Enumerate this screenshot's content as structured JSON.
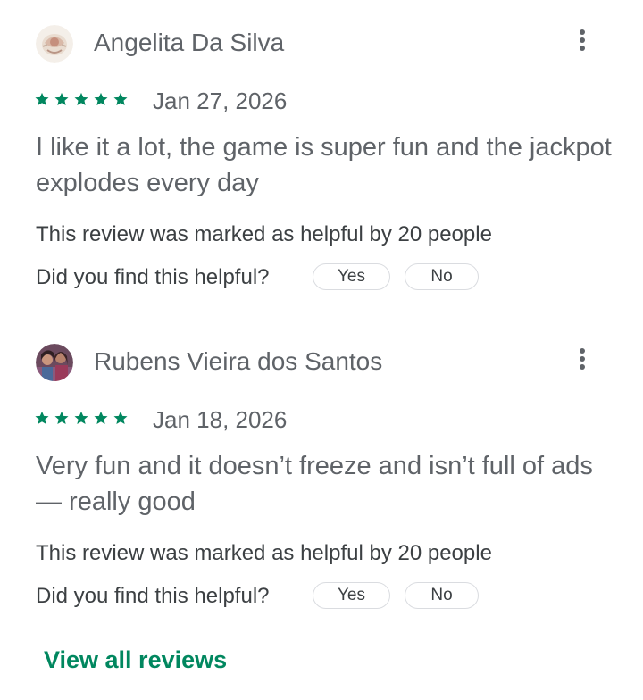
{
  "colors": {
    "star": "#01875f",
    "link": "#01875f",
    "name_text": "#5f6368",
    "body_text": "#5f6368",
    "meta_text": "#3c4043",
    "button_border": "#dadce0"
  },
  "reviews": [
    {
      "reviewer_name": "Angelita Da Silva",
      "avatar_icon": "ornate-crest-avatar",
      "more_icon": "more-vert-icon",
      "rating": 5,
      "date": "Jan 27, 2026",
      "text": "I like it a lot, the game is super fun and the jackpot explodes every day",
      "helpful_count_text": "This review was marked as helpful by 20 people",
      "helpful_question": "Did you find this helpful?",
      "yes_label": "Yes",
      "no_label": "No"
    },
    {
      "reviewer_name": "Rubens Vieira dos Santos",
      "avatar_icon": "group-photo-avatar",
      "more_icon": "more-vert-icon",
      "rating": 5,
      "date": "Jan 18, 2026",
      "text": "Very fun and it doesn’t freeze and isn’t full of ads — really good",
      "helpful_count_text": "This review was marked as helpful by 20 people",
      "helpful_question": "Did you find this helpful?",
      "yes_label": "Yes",
      "no_label": "No"
    }
  ],
  "footer": {
    "view_all_label": "View all reviews"
  }
}
